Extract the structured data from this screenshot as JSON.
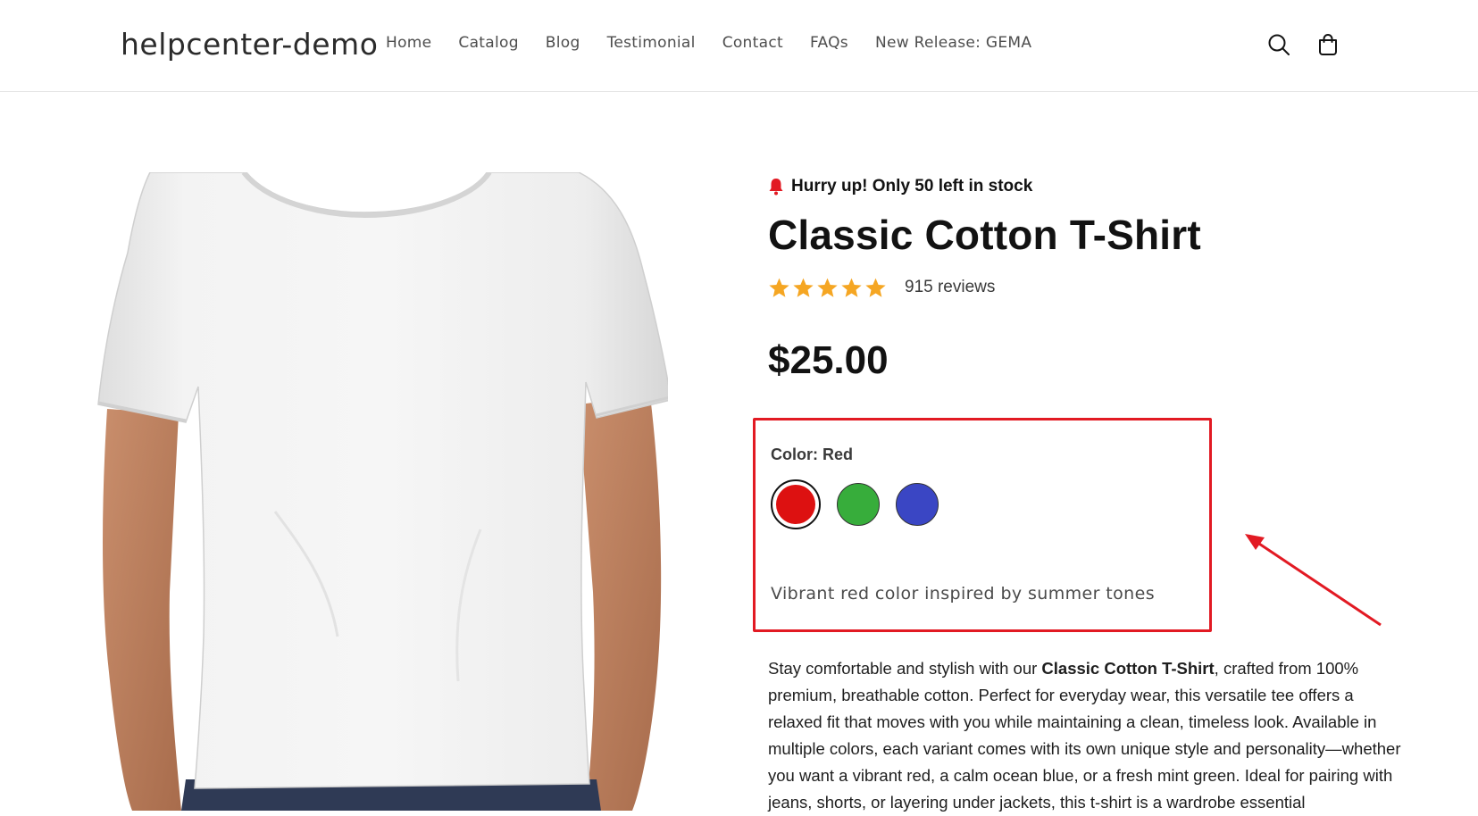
{
  "header": {
    "brand": "helpcenter-demo",
    "nav": [
      "Home",
      "Catalog",
      "Blog",
      "Testimonial",
      "Contact",
      "FAQs",
      "New Release: GEMA"
    ],
    "icons": [
      "search-icon",
      "cart-icon"
    ]
  },
  "product": {
    "stock_notice": "Hurry up! Only 50 left in stock",
    "title": "Classic Cotton T-Shirt",
    "rating": 5,
    "reviews": "915 reviews",
    "price": "$25.00",
    "image_alt": "white t-shirt",
    "variant": {
      "label": "Color: Red",
      "swatches": [
        {
          "name": "Red",
          "color": "#dd1111",
          "selected": true
        },
        {
          "name": "Green",
          "color": "#37ad3b",
          "selected": false
        },
        {
          "name": "Blue",
          "color": "#3a46c4",
          "selected": false
        }
      ],
      "description": "Vibrant red color inspired by summer tones"
    },
    "description": {
      "intro": "Stay comfortable and stylish with our ",
      "bold": "Classic Cotton T-Shirt",
      "rest": ", crafted from 100% premium, breathable cotton. Perfect for everyday wear, this versatile tee offers a relaxed fit that moves with you while maintaining a clean, timeless look. Available in multiple colors, each variant comes with its own unique style and personality—whether you want a vibrant red, a calm ocean blue, or a fresh mint green. Ideal for pairing with jeans, shorts, or layering under jackets, this t-shirt is a wardrobe essential"
    }
  },
  "colors": {
    "accent_highlight": "#e21a23",
    "star": "#f5a623",
    "text": "#121212"
  }
}
